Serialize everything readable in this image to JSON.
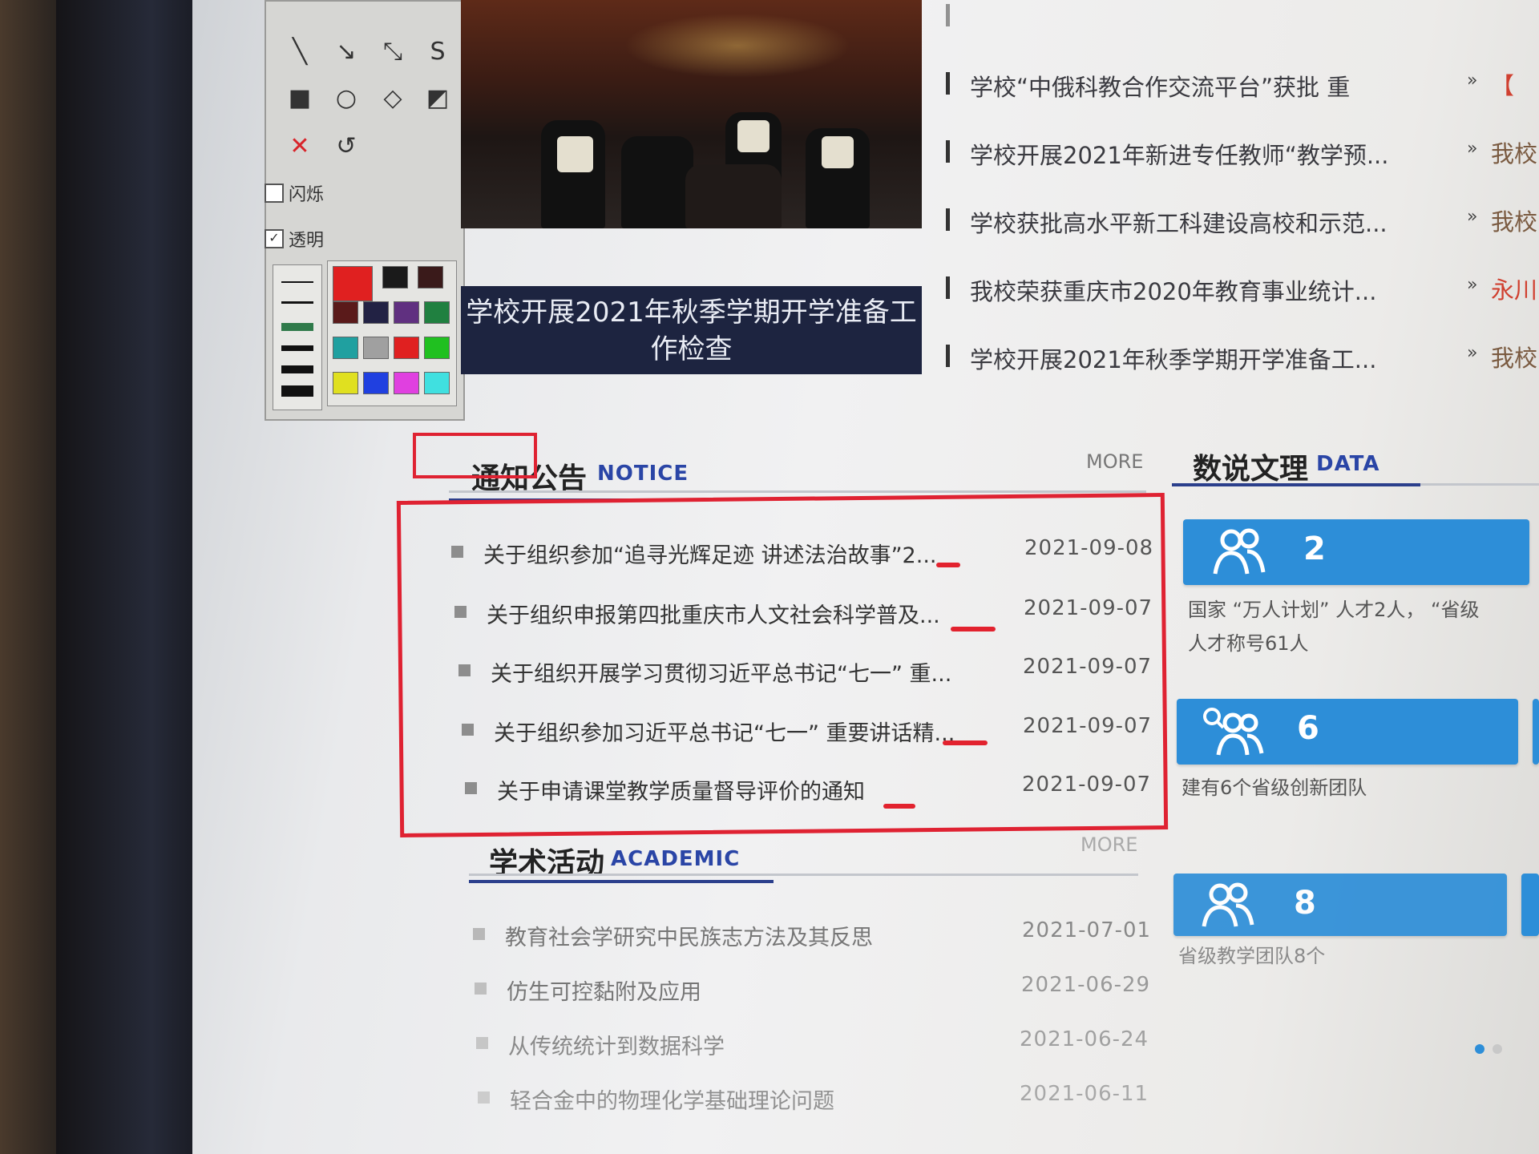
{
  "toolbox": {
    "flash_label": "闪烁",
    "transparent_label": "透明",
    "swatch_colors": [
      "#1a1a1a",
      "#3a1a1a",
      "#5a1a1a",
      "#222244",
      "#603080",
      "#208040",
      "#20a0a0",
      "#a0a0a0",
      "#e02020",
      "#20c020",
      "#e0e020",
      "#2040e0",
      "#e040e0",
      "#40e0e0",
      "#ffffff"
    ],
    "active_color": "#e02020"
  },
  "hero": {
    "caption": "学校开展2021年秋季学期开学准备工作检查"
  },
  "headlines": [
    {
      "title": "学校“中俄科教合作交流平台”获批 重",
      "tag": "【"
    },
    {
      "title": "学校开展2021年新进专任教师“教学预...",
      "tag": "我校"
    },
    {
      "title": "学校获批高水平新工科建设高校和示范...",
      "tag": "我校"
    },
    {
      "title": "我校荣获重庆市2020年教育事业统计...",
      "tag": "永川"
    },
    {
      "title": "学校开展2021年秋季学期开学准备工...",
      "tag": "我校"
    }
  ],
  "notice": {
    "title": "通知公告",
    "en": "NOTICE",
    "more": "MORE",
    "items": [
      {
        "text": "关于组织参加“追寻光辉足迹 讲述法治故事”2...",
        "date": "2021-09-08"
      },
      {
        "text": "关于组织申报第四批重庆市人文社会科学普及...",
        "date": "2021-09-07"
      },
      {
        "text": "关于组织开展学习贯彻习近平总书记“七一” 重...",
        "date": "2021-09-07"
      },
      {
        "text": "关于组织参加习近平总书记“七一” 重要讲话精...",
        "date": "2021-09-07"
      },
      {
        "text": "关于申请课堂教学质量督导评价的通知",
        "date": "2021-09-07"
      }
    ]
  },
  "academic": {
    "title": "学术活动",
    "en": "ACADEMIC",
    "more": "MORE",
    "items": [
      {
        "text": "教育社会学研究中民族志方法及其反思",
        "date": "2021-07-01"
      },
      {
        "text": "仿生可控黏附及应用",
        "date": "2021-06-29"
      },
      {
        "text": "从传统统计到数据科学",
        "date": "2021-06-24"
      },
      {
        "text": "轻合金中的物理化学基础理论问题",
        "date": "2021-06-11"
      }
    ]
  },
  "data_section": {
    "title": "数说文理",
    "en": "DATA",
    "cards": [
      {
        "number": "2",
        "desc1": "国家 “万人计划” 人才2人， “省级",
        "desc2": "人才称号61人"
      },
      {
        "number": "6",
        "desc1": "建有6个省级创新团队",
        "desc2": ""
      },
      {
        "number": "8",
        "desc1": "省级教学团队8个",
        "desc2": ""
      }
    ]
  },
  "colors": {
    "accent_blue": "#2d8ed8",
    "section_en_blue": "#2a45a6",
    "annotation_red": "#df2232"
  }
}
